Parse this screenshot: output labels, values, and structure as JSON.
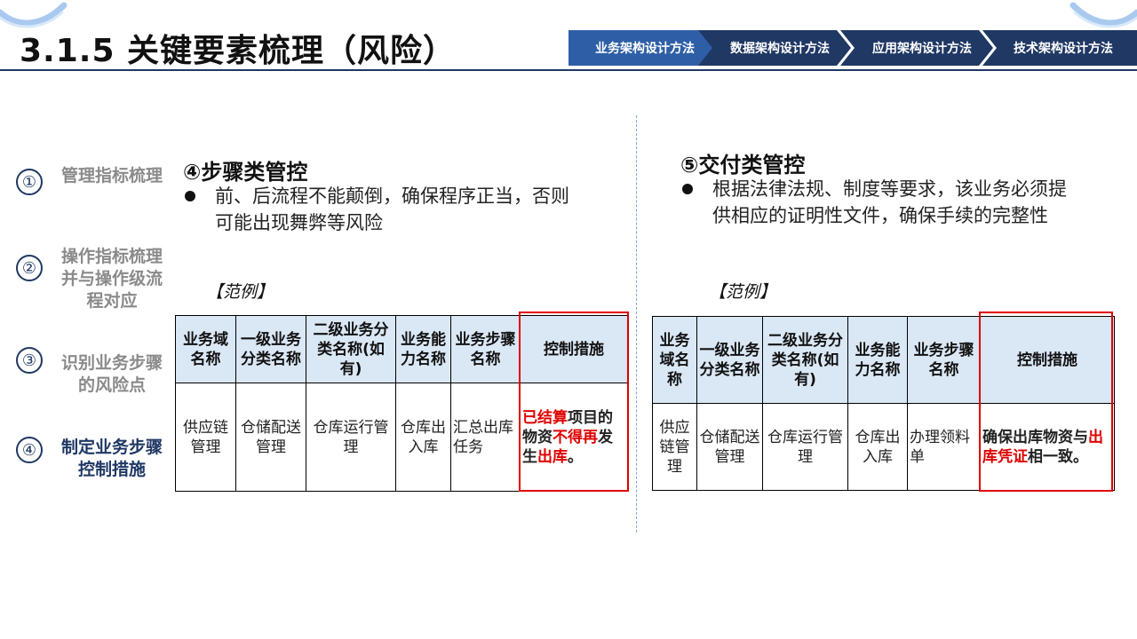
{
  "page": {
    "title": "3.1.5 关键要素梳理（风险）"
  },
  "nav": {
    "steps": [
      {
        "label": "业务架构设计方法",
        "active": true
      },
      {
        "label": "数据架构设计方法",
        "active": false
      },
      {
        "label": "应用架构设计方法",
        "active": false
      },
      {
        "label": "技术架构设计方法",
        "active": false
      }
    ]
  },
  "sidebar": {
    "items": [
      {
        "num": "①",
        "label": "管理指标梳理",
        "active": false
      },
      {
        "num": "②",
        "label": "操作指标梳理并与操作级流程对应",
        "active": false
      },
      {
        "num": "③",
        "label": "识别业务步骤的风险点",
        "active": false
      },
      {
        "num": "④",
        "label": "制定业务步骤控制措施",
        "active": true
      }
    ]
  },
  "left": {
    "title": "④步骤类管控",
    "bullet": "前、后流程不能颠倒，确保程序正当，否则可能出现舞弊等风险",
    "example": "【范例】",
    "table": {
      "headers": [
        "业务域名称",
        "一级业务分类名称",
        "二级业务分类名称(如有)",
        "业务能力名称",
        "业务步骤名称",
        "控制措施"
      ],
      "row": [
        "供应链管理",
        "仓储配送管理",
        "仓库运行管理",
        "仓库出入库",
        "汇总出库任务"
      ],
      "control_parts": [
        "已结算",
        "项目的物资",
        "不得再",
        "发生",
        "出库",
        "。"
      ]
    }
  },
  "right": {
    "title": "⑤交付类管控",
    "bullet": "根据法律法规、制度等要求，该业务必须提供相应的证明性文件，确保手续的完整性",
    "example": "【范例】",
    "table": {
      "headers": [
        "业务域名称",
        "一级业务分类名称",
        "二级业务分类名称(如有)",
        "业务能力名称",
        "业务步骤名称",
        "控制措施"
      ],
      "row": [
        "供应链管理",
        "仓储配送管理",
        "仓库运行管理",
        "仓库出入库",
        "办理领料单"
      ],
      "control_parts": [
        "确保出库物资与",
        "出库凭证",
        "相一致。"
      ]
    }
  },
  "colors": {
    "navy": "#1f3864",
    "nav_active": "#2e5fa6",
    "header_fill": "#dae7f5",
    "highlight_red": "#e00000"
  }
}
